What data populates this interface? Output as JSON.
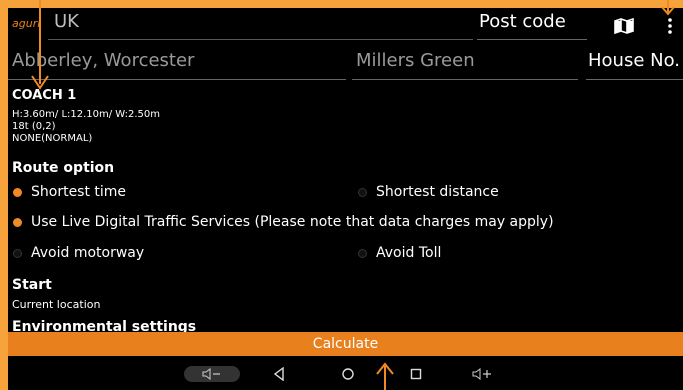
{
  "topbar": {
    "logo": "aguri",
    "country": "UK",
    "postcode_placeholder": "Post code"
  },
  "address": {
    "town": "Abberley, Worcester",
    "street": "Millers Green",
    "house_no": "House No."
  },
  "vehicle": {
    "name": "COACH 1",
    "dimensions": "H:3.60m/ L:12.10m/ W:2.50m",
    "weight": "18t (0,2)",
    "hazard": "NONE(NORMAL)"
  },
  "route": {
    "title": "Route option",
    "options": [
      {
        "label": "Shortest time",
        "selected": true
      },
      {
        "label": "Shortest distance",
        "selected": false
      },
      {
        "label": "Use Live Digital Traffic Services (Please note that data charges may apply)",
        "selected": true
      },
      {
        "label": "Avoid motorway",
        "selected": false
      },
      {
        "label": "Avoid Toll",
        "selected": false
      }
    ]
  },
  "start": {
    "title": "Start",
    "value": "Current location"
  },
  "environment": {
    "title": "Environmental settings"
  },
  "actions": {
    "calculate": "Calculate"
  },
  "navbar": {
    "icons": [
      "volume-down-icon",
      "back-icon",
      "home-icon",
      "recents-icon",
      "volume-up-icon"
    ]
  },
  "colors": {
    "accent": "#e8801e",
    "frame": "#f5a33a",
    "background": "#000000"
  }
}
